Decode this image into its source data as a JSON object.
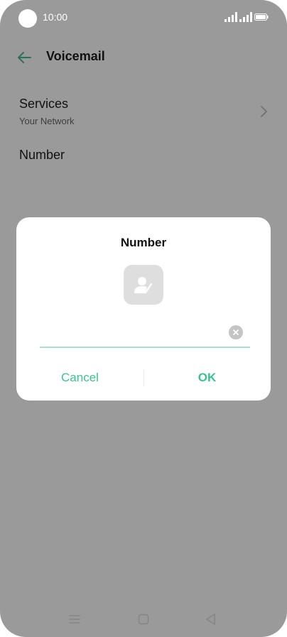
{
  "status_bar": {
    "time": "10:00"
  },
  "header": {
    "title": "Voicemail"
  },
  "settings": {
    "services_label": "Services",
    "services_sub": "Your Network",
    "number_label": "Number"
  },
  "dialog": {
    "title": "Number",
    "input_value": "",
    "cancel_label": "Cancel",
    "ok_label": "OK"
  },
  "colors": {
    "accent": "#37c58d",
    "overlay": "#9a9a9a"
  }
}
